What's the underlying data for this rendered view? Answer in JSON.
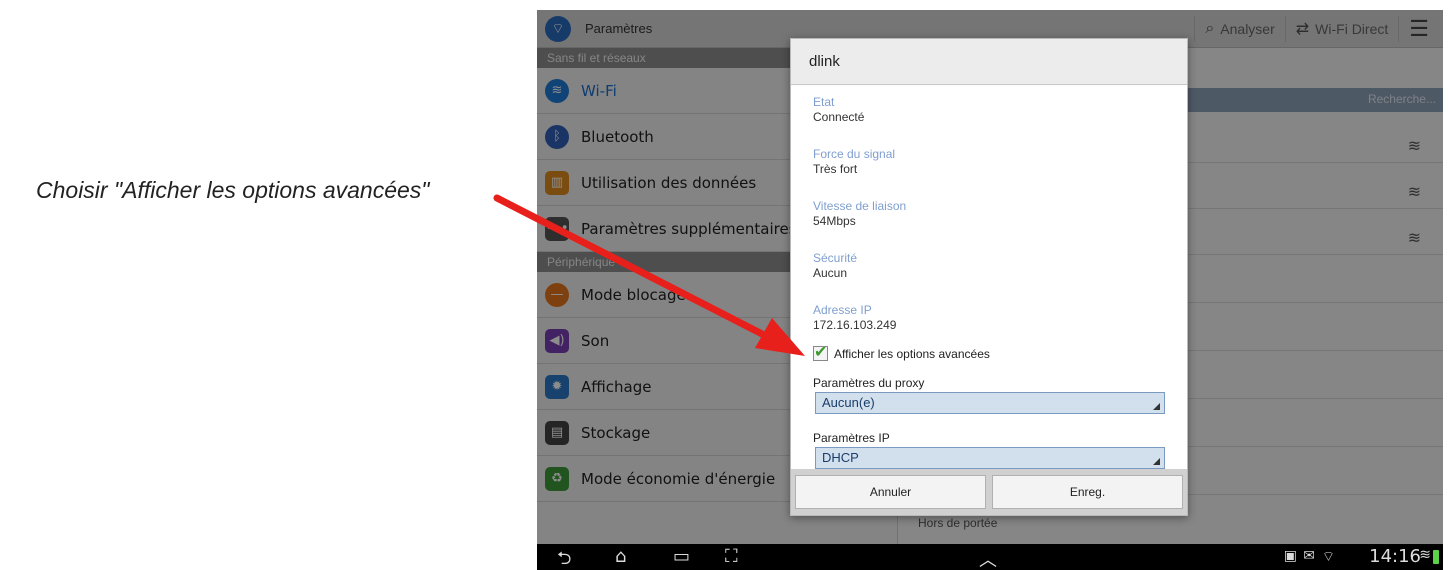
{
  "annotation": {
    "text": "Choisir \"Afficher les options avancées\""
  },
  "actionbar": {
    "title": "Paramètres",
    "analyze_label": "Analyser",
    "wifi_direct_label": "Wi-Fi Direct"
  },
  "settings": {
    "section_wireless": "Sans fil et réseaux",
    "section_device": "Périphérique",
    "items": [
      {
        "label": "Wi-Fi",
        "icon": "wifi-icon",
        "active": true
      },
      {
        "label": "Bluetooth",
        "icon": "bluetooth-icon"
      },
      {
        "label": "Utilisation des données",
        "icon": "data-usage-icon"
      },
      {
        "label": "Paramètres supplémentaires",
        "icon": "more-settings-icon"
      },
      {
        "label": "Mode blocage",
        "icon": "blocking-mode-icon"
      },
      {
        "label": "Son",
        "icon": "sound-icon"
      },
      {
        "label": "Affichage",
        "icon": "display-icon"
      },
      {
        "label": "Stockage",
        "icon": "storage-icon"
      },
      {
        "label": "Mode économie d'énergie",
        "icon": "power-saving-icon"
      }
    ]
  },
  "wifi_panel": {
    "searching_label": "Recherche...",
    "out_of_range": "Hors de portée"
  },
  "dialog": {
    "title": "dlink",
    "fields": [
      {
        "label": "Etat",
        "value": "Connecté"
      },
      {
        "label": "Force du signal",
        "value": "Très fort"
      },
      {
        "label": "Vitesse de liaison",
        "value": "54Mbps"
      },
      {
        "label": "Sécurité",
        "value": "Aucun"
      },
      {
        "label": "Adresse IP",
        "value": "172.16.103.249"
      }
    ],
    "advanced_checkbox": {
      "label": "Afficher les options avancées",
      "checked": true
    },
    "proxy_label": "Paramètres du proxy",
    "proxy_value": "Aucun(e)",
    "ip_label": "Paramètres IP",
    "ip_value": "DHCP",
    "cancel_label": "Annuler",
    "save_label": "Enreg."
  },
  "statusbar": {
    "time": "14:16"
  },
  "colors": {
    "accent": "#1a6fd0",
    "arrow": "#e8201c",
    "checkbox_check": "#3a9a2a"
  }
}
